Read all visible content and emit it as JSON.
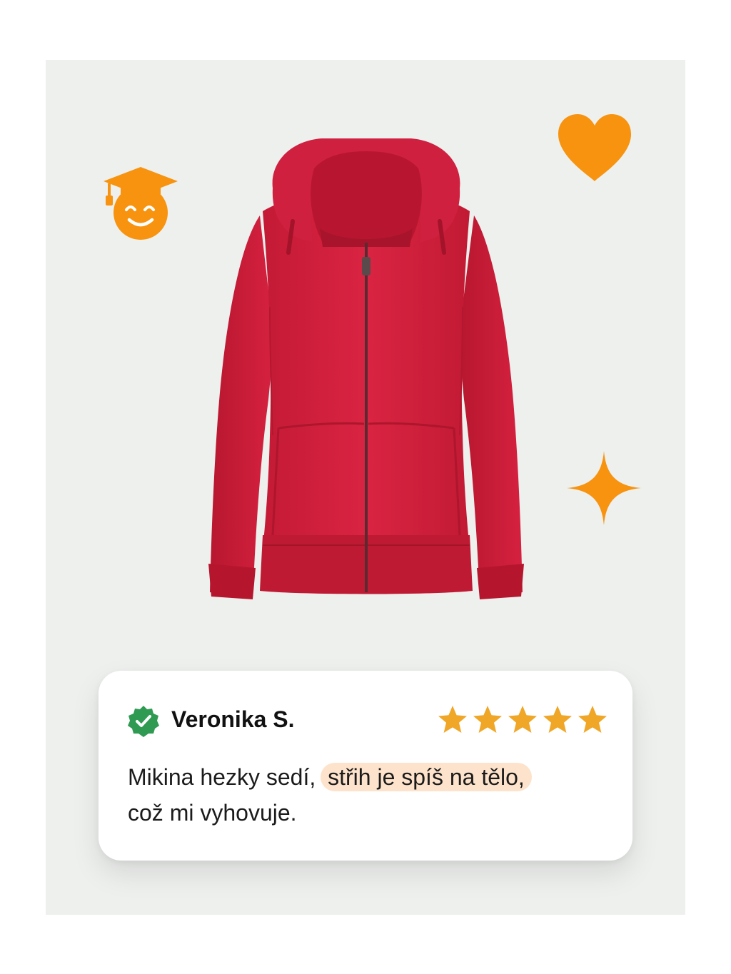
{
  "review": {
    "name": "Veronika S.",
    "rating": 5,
    "rating_max": 5,
    "text_part1": "Mikina hezky sedí, ",
    "text_highlight": "střih je spíš na tělo,",
    "text_part2": "což mi vyhovuje."
  },
  "product": {
    "color": "#d21f3c"
  },
  "icons": {
    "badge": "verified-check-icon",
    "star": "star-icon",
    "decorations": [
      "graduation-smiley-icon",
      "heart-icon",
      "sparkle-icon"
    ]
  },
  "colors": {
    "accent": "#f7930e",
    "star": "#f0a626",
    "verified": "#2e9a52",
    "highlight": "#fde3cb",
    "background": "#eef0ee"
  }
}
